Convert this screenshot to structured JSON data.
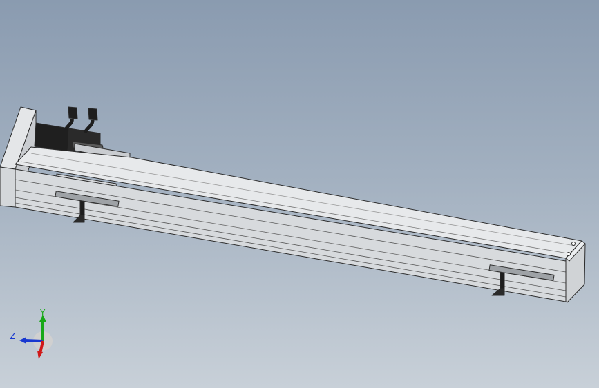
{
  "viewport": {
    "background_top": "#8a9bb0",
    "background_bottom": "#c8d0d8"
  },
  "model": {
    "part": "linear-actuator-module",
    "color_body": "#d9dcdf",
    "color_edges": "#2b2b2b",
    "color_motor": "#1f1f1f"
  },
  "triad": {
    "y_label": "Y",
    "z_label": "Z",
    "x_color": "#d01818",
    "y_color": "#18a818",
    "z_color": "#1838d0"
  }
}
